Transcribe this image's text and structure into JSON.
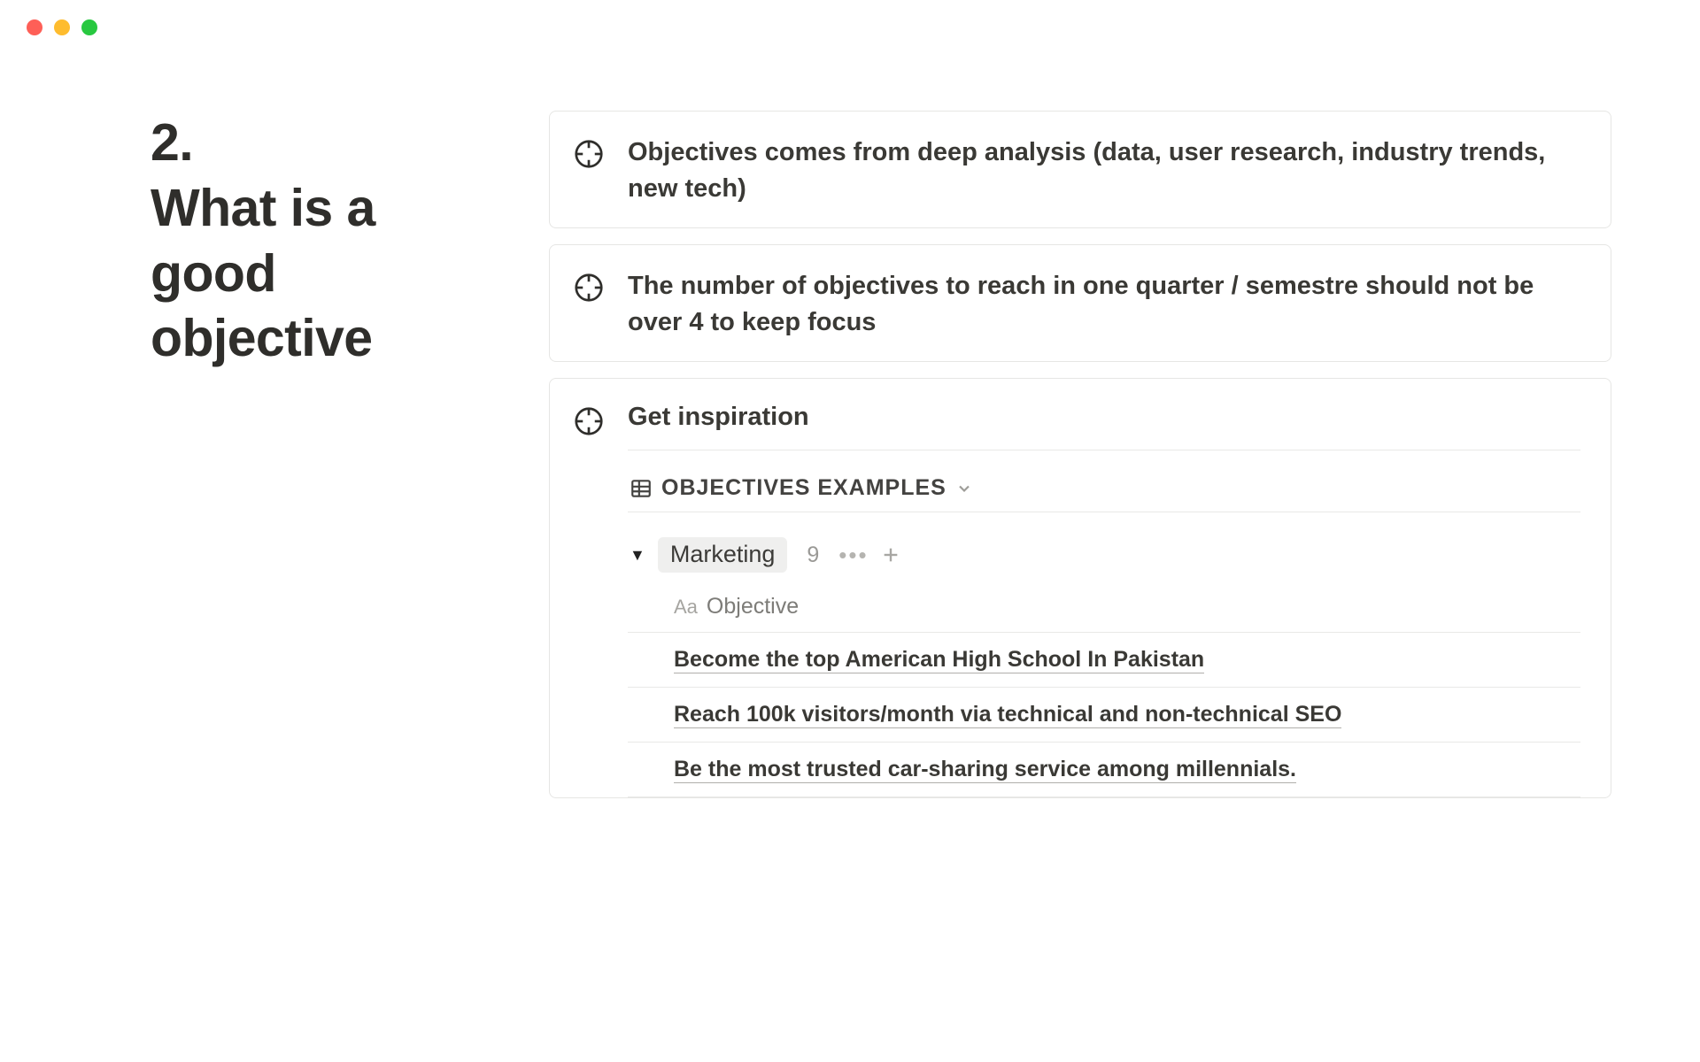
{
  "heading": {
    "number": "2.",
    "line1": "What is a",
    "line2": "good",
    "line3": "objective"
  },
  "cards": [
    {
      "text": "Objectives comes from deep analysis (data, user research, industry trends, new tech)"
    },
    {
      "text": "The number of objectives to reach in one quarter / semestre should not be over 4 to keep focus"
    }
  ],
  "inspiration": {
    "title": "Get inspiration",
    "view_name": "OBJECTIVES EXAMPLES",
    "group": {
      "name": "Marketing",
      "count": "9"
    },
    "column_header": "Objective",
    "rows": [
      "Become the top American High School In Pakistan",
      "Reach 100k visitors/month via technical and non-technical SEO",
      "Be the most trusted car-sharing service among millennials."
    ]
  }
}
